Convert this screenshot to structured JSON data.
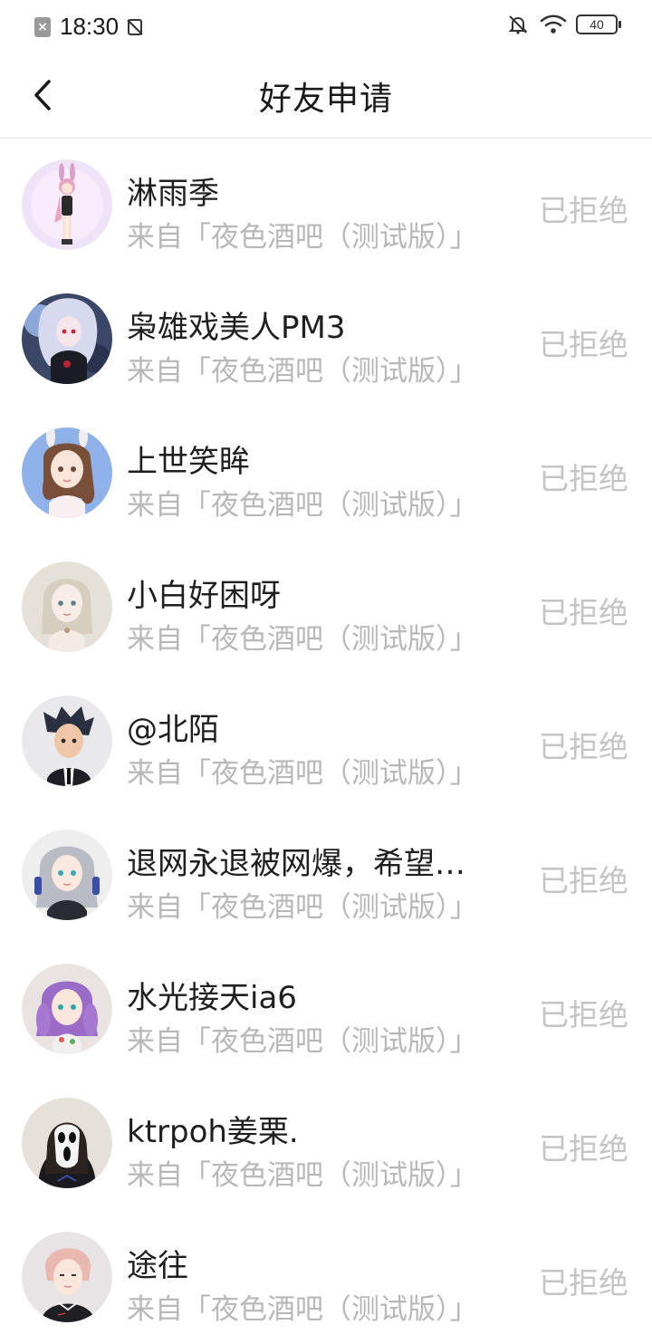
{
  "status_bar": {
    "time": "18:30",
    "battery": "40"
  },
  "header": {
    "title": "好友申请"
  },
  "requests": [
    {
      "name": "淋雨季",
      "source": "来自「夜色酒吧（测试版）」",
      "status": "已拒绝"
    },
    {
      "name": "枭雄戏美人PM3",
      "source": "来自「夜色酒吧（测试版）」",
      "status": "已拒绝"
    },
    {
      "name": "上世笑眸",
      "source": "来自「夜色酒吧（测试版）」",
      "status": "已拒绝"
    },
    {
      "name": "小白好困呀",
      "source": "来自「夜色酒吧（测试版）」",
      "status": "已拒绝"
    },
    {
      "name": "@北陌",
      "source": "来自「夜色酒吧（测试版）」",
      "status": "已拒绝"
    },
    {
      "name": "退网永退被网爆，希望…",
      "source": "来自「夜色酒吧（测试版）」",
      "status": "已拒绝"
    },
    {
      "name": "水光接天ia6",
      "source": "来自「夜色酒吧（测试版）」",
      "status": "已拒绝"
    },
    {
      "name": "ktrpoh姜栗.",
      "source": "来自「夜色酒吧（测试版）」",
      "status": "已拒绝"
    },
    {
      "name": "途往",
      "source": "来自「夜色酒吧（测试版）」",
      "status": "已拒绝"
    }
  ],
  "colors": {
    "name_text": "#1f1f1f",
    "secondary_text": "#b8b8b8",
    "status_text": "#c4c4c4",
    "divider": "#e8e8e8"
  },
  "icons": {
    "back": "chevron-left-icon",
    "bell": "bell-off-icon",
    "wifi": "wifi-icon",
    "battery": "battery-icon"
  }
}
